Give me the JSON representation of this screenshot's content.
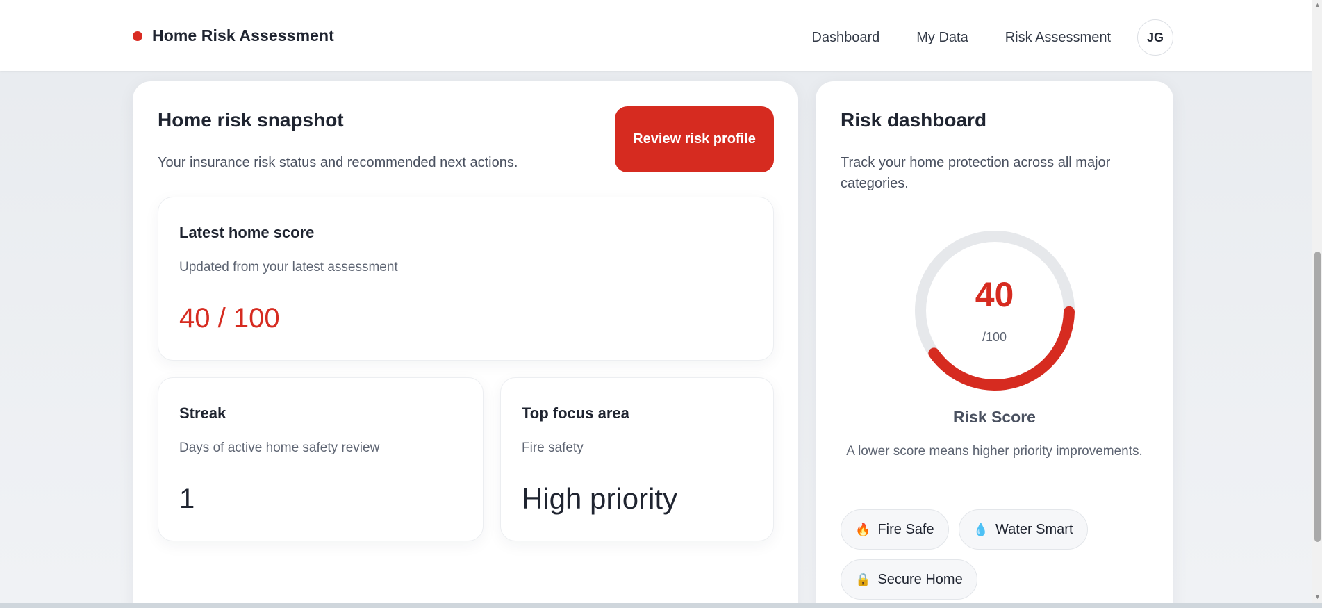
{
  "header": {
    "brand_title": "Home Risk Assessment",
    "nav": [
      "Dashboard",
      "My Data",
      "Risk Assessment"
    ],
    "avatar_initials": "JG"
  },
  "snapshot": {
    "title": "Home risk snapshot",
    "subtitle": "Your insurance risk status and recommended next actions.",
    "review_button": "Review risk profile",
    "score_card": {
      "title": "Latest home score",
      "subtitle": "Updated from your latest assessment",
      "value": "40 / 100"
    },
    "streak_card": {
      "title": "Streak",
      "subtitle": "Days of active home safety review",
      "value": "1"
    },
    "focus_card": {
      "title": "Top focus area",
      "subtitle": "Fire safety",
      "value": "High priority"
    }
  },
  "dashboard": {
    "title": "Risk dashboard",
    "subtitle": "Track your home protection across all major categories.",
    "gauge": {
      "score": 40,
      "max": 100,
      "score_text": "40",
      "denominator_text": "/100",
      "label": "Risk Score",
      "note": "A lower score means higher priority improvements."
    },
    "chips": [
      {
        "icon": "fire-icon",
        "glyph": "🔥",
        "label": "Fire Safe"
      },
      {
        "icon": "water-drop-icon",
        "glyph": "💧",
        "label": "Water Smart"
      },
      {
        "icon": "lock-icon",
        "glyph": "🔒",
        "label": "Secure Home"
      }
    ]
  },
  "colors": {
    "accent": "#d62b20",
    "gauge_track": "#e6e8eb"
  }
}
